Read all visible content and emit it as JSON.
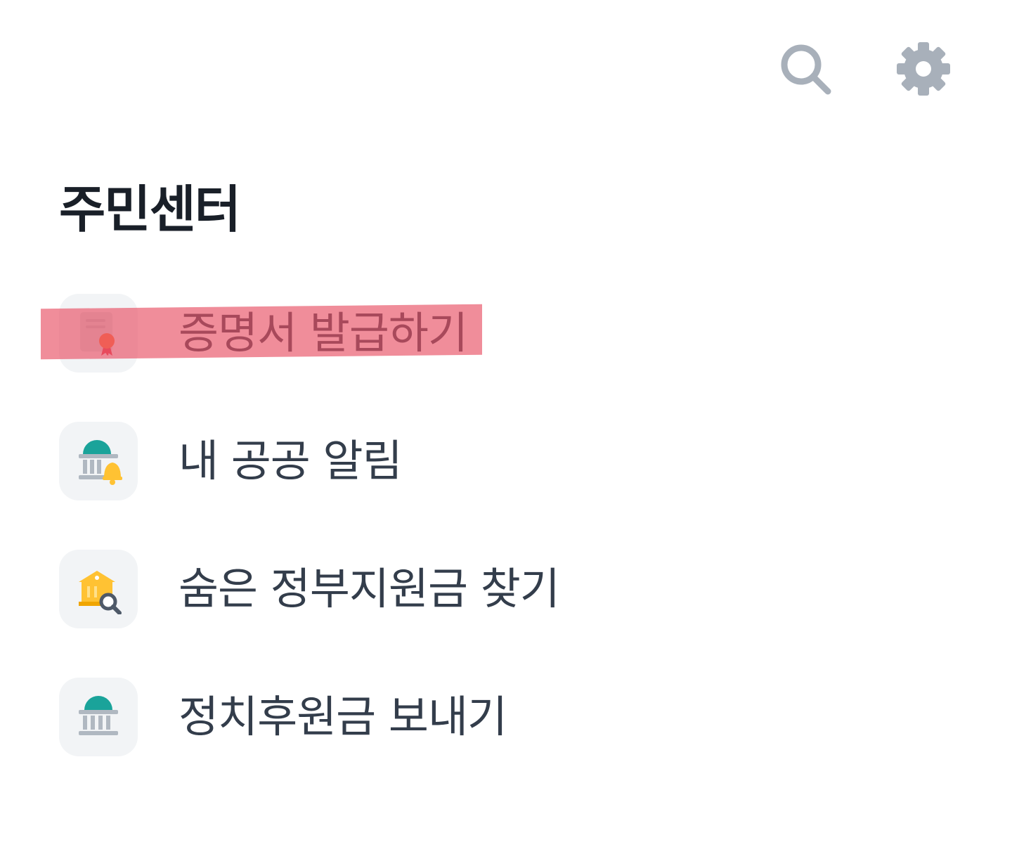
{
  "header": {
    "search_icon": "search-icon",
    "settings_icon": "gear-icon",
    "icon_color": "#a8b0ba"
  },
  "page": {
    "title": "주민센터"
  },
  "menu": {
    "items": [
      {
        "label": "증명서 발급하기",
        "icon": "certificate-icon",
        "highlighted": true
      },
      {
        "label": "내 공공 알림",
        "icon": "government-bell-icon"
      },
      {
        "label": "숨은 정부지원금 찾기",
        "icon": "building-search-icon"
      },
      {
        "label": "정치후원금 보내기",
        "icon": "government-building-icon"
      }
    ]
  },
  "colors": {
    "title": "#191f28",
    "label": "#333d4b",
    "icon_bg": "#f2f4f6",
    "highlight": "#e85064",
    "teal": "#1aa39a",
    "yellow": "#ffc233",
    "gray": "#b0b8c1"
  }
}
